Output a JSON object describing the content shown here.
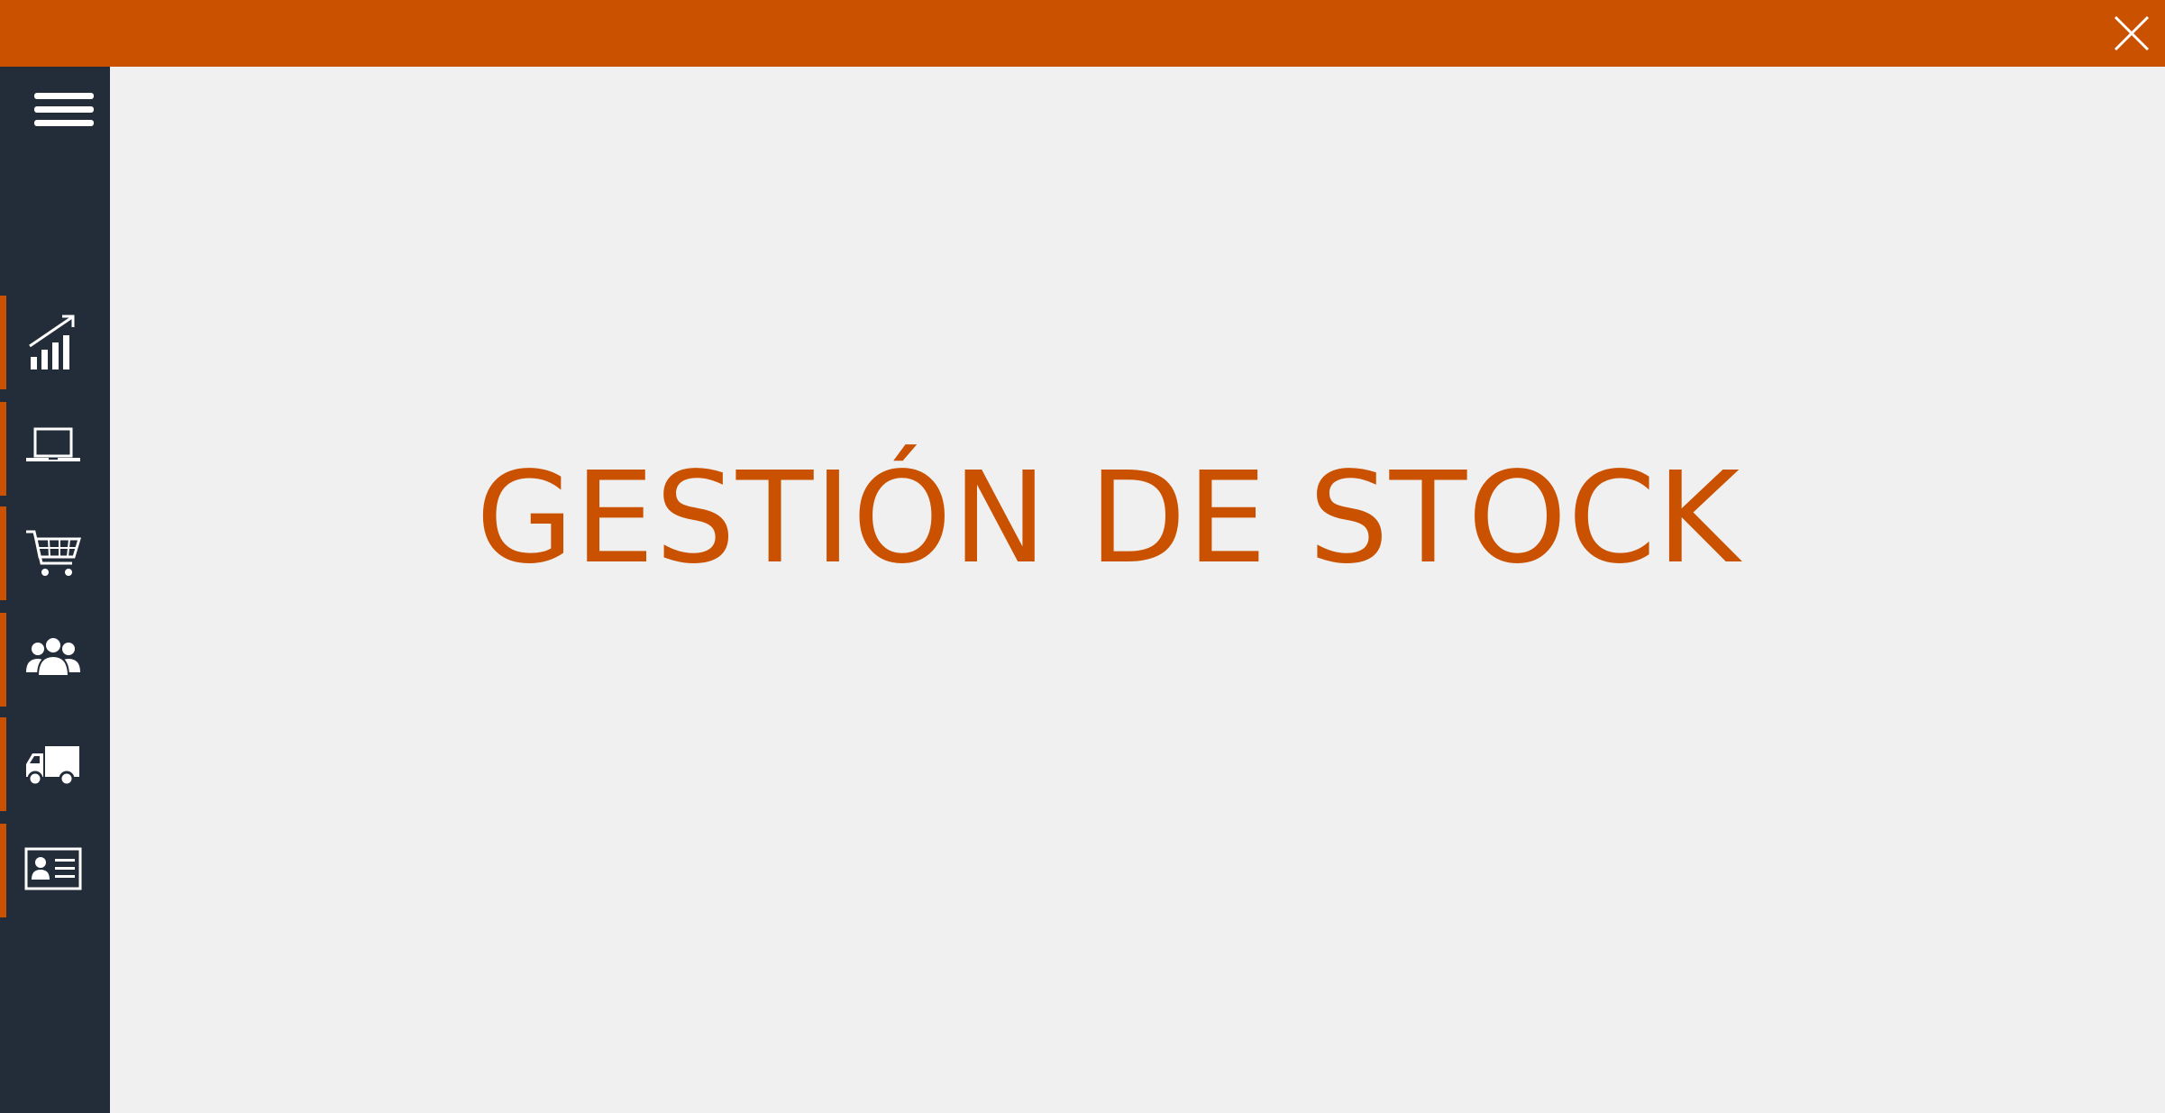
{
  "window": {
    "close_icon": "close-icon",
    "titlebar_color": "#ca5100"
  },
  "sidebar": {
    "background": "#232d3a",
    "accent_color": "#ca5100",
    "menu_icon": "hamburger-menu-icon",
    "items": [
      {
        "id": "statistics",
        "icon": "bar-chart-growth-icon"
      },
      {
        "id": "laptop",
        "icon": "laptop-icon"
      },
      {
        "id": "shopping",
        "icon": "shopping-cart-icon"
      },
      {
        "id": "customers",
        "icon": "users-group-icon"
      },
      {
        "id": "delivery",
        "icon": "delivery-truck-icon"
      },
      {
        "id": "contacts",
        "icon": "contact-card-icon"
      }
    ]
  },
  "main": {
    "title": "GESTIÓN DE STOCK",
    "title_color": "#ca5100"
  }
}
